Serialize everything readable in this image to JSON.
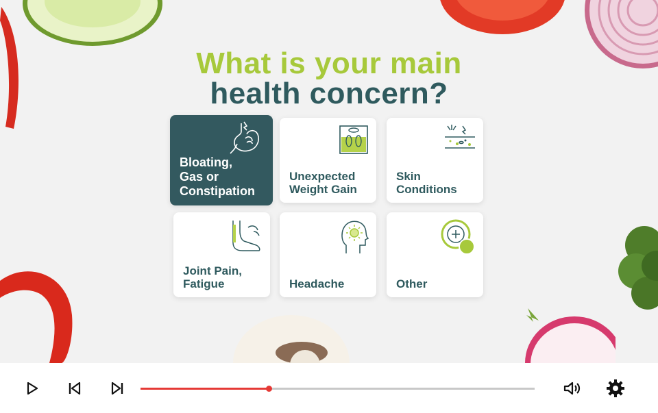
{
  "question": {
    "line1": "What is your main",
    "line2": "health concern?"
  },
  "options": [
    {
      "label_lines": [
        "Bloating,",
        "Gas or",
        "Constipation"
      ],
      "icon": "stomach-icon",
      "selected": true
    },
    {
      "label_lines": [
        "Unexpected",
        "Weight Gain"
      ],
      "icon": "scale-icon",
      "selected": false
    },
    {
      "label_lines": [
        "Skin",
        "Conditions"
      ],
      "icon": "skin-icon",
      "selected": false
    },
    {
      "label_lines": [
        "Joint Pain,",
        "Fatigue"
      ],
      "icon": "leg-icon",
      "selected": false
    },
    {
      "label_lines": [
        "Headache"
      ],
      "icon": "head-icon",
      "selected": false
    },
    {
      "label_lines": [
        "Other"
      ],
      "icon": "plus-circle-icon",
      "selected": false
    }
  ],
  "player": {
    "progress": 0.326,
    "icons": [
      "play-icon",
      "previous-icon",
      "next-icon",
      "volume-icon",
      "settings-icon"
    ]
  },
  "colors": {
    "accent_green": "#a7c93b",
    "teal": "#2f5a5e",
    "selected_card": "#33595f",
    "progress_red": "#e53935"
  }
}
